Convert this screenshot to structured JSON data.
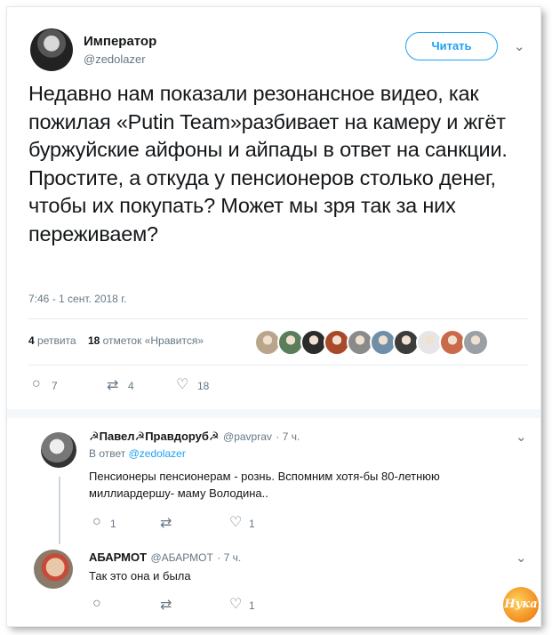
{
  "tweet": {
    "author_name": "Император",
    "author_handle": "@zedolazer",
    "follow_label": "Читать",
    "text": "Недавно нам показали резонансное видео, как пожилая «Putin Team»разбивает на камеру и жгёт буржуйские айфоны и айпады в ответ на санкции. Простите, а откуда у пенсионеров столько денег, чтобы их покупать? Может мы зря так за них переживаем?",
    "timestamp": "7:46 - 1 сент. 2018 г.",
    "retweets_count": "4",
    "retweets_label": "ретвита",
    "likes_count": "18",
    "likes_label": "отметок «Нравится»",
    "actions": {
      "replies": "7",
      "retweets": "4",
      "likes": "18"
    }
  },
  "liker_colors": [
    "#b9a58c",
    "#5a7d5a",
    "#2b2b2b",
    "#a84a2a",
    "#8a8a8a",
    "#6f8fa8",
    "#3c3c3c",
    "#e6e6e6",
    "#c96a4a",
    "#9aa0a6"
  ],
  "replies": [
    {
      "name": "☭Павел☭Правдоруб☭",
      "handle": "@pavprav",
      "time": "· 7 ч.",
      "reply_to_prefix": "В ответ",
      "reply_to_handle": "@zedolazer",
      "text": "Пенсионеры пенсионерам - рознь. Вспомним хотя-бы 80-летнюю миллиардершу- маму Володина..",
      "actions": {
        "replies": "1",
        "retweets": "",
        "likes": "1"
      }
    },
    {
      "name": "АБАРМОТ",
      "handle": "@АБАРМОТ",
      "time": "· 7 ч.",
      "text": "Так это она и была",
      "actions": {
        "replies": "",
        "retweets": "",
        "likes": "1"
      }
    }
  ],
  "watermark": "Нука"
}
